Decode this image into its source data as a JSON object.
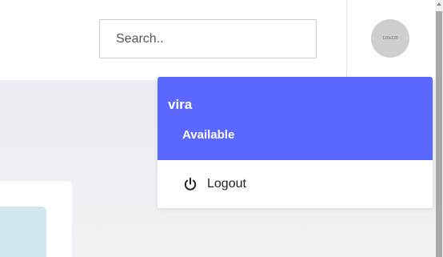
{
  "header": {
    "search": {
      "placeholder": "Search..",
      "value": ""
    },
    "avatar": {
      "label": "120x120"
    }
  },
  "user_menu": {
    "name": "vira",
    "status": "Available",
    "items": [
      {
        "label": "Logout",
        "icon": "power-icon"
      }
    ]
  },
  "colors": {
    "menu_header": "#5b68ff",
    "content_bg": "#ececf3",
    "card_accent": "#cfe7ee"
  }
}
